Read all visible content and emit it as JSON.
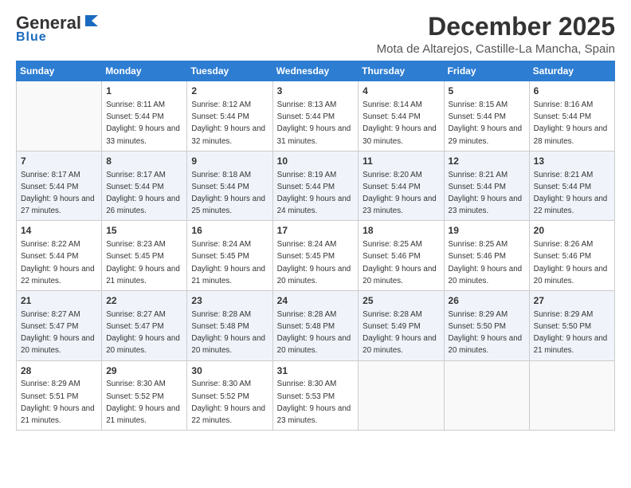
{
  "header": {
    "logo_general": "General",
    "logo_blue": "Blue",
    "month_title": "December 2025",
    "location": "Mota de Altarejos, Castille-La Mancha, Spain"
  },
  "days_of_week": [
    "Sunday",
    "Monday",
    "Tuesday",
    "Wednesday",
    "Thursday",
    "Friday",
    "Saturday"
  ],
  "weeks": [
    [
      {
        "day": "",
        "sunrise": "",
        "sunset": "",
        "daylight": ""
      },
      {
        "day": "1",
        "sunrise": "Sunrise: 8:11 AM",
        "sunset": "Sunset: 5:44 PM",
        "daylight": "Daylight: 9 hours and 33 minutes."
      },
      {
        "day": "2",
        "sunrise": "Sunrise: 8:12 AM",
        "sunset": "Sunset: 5:44 PM",
        "daylight": "Daylight: 9 hours and 32 minutes."
      },
      {
        "day": "3",
        "sunrise": "Sunrise: 8:13 AM",
        "sunset": "Sunset: 5:44 PM",
        "daylight": "Daylight: 9 hours and 31 minutes."
      },
      {
        "day": "4",
        "sunrise": "Sunrise: 8:14 AM",
        "sunset": "Sunset: 5:44 PM",
        "daylight": "Daylight: 9 hours and 30 minutes."
      },
      {
        "day": "5",
        "sunrise": "Sunrise: 8:15 AM",
        "sunset": "Sunset: 5:44 PM",
        "daylight": "Daylight: 9 hours and 29 minutes."
      },
      {
        "day": "6",
        "sunrise": "Sunrise: 8:16 AM",
        "sunset": "Sunset: 5:44 PM",
        "daylight": "Daylight: 9 hours and 28 minutes."
      }
    ],
    [
      {
        "day": "7",
        "sunrise": "Sunrise: 8:17 AM",
        "sunset": "Sunset: 5:44 PM",
        "daylight": "Daylight: 9 hours and 27 minutes."
      },
      {
        "day": "8",
        "sunrise": "Sunrise: 8:17 AM",
        "sunset": "Sunset: 5:44 PM",
        "daylight": "Daylight: 9 hours and 26 minutes."
      },
      {
        "day": "9",
        "sunrise": "Sunrise: 8:18 AM",
        "sunset": "Sunset: 5:44 PM",
        "daylight": "Daylight: 9 hours and 25 minutes."
      },
      {
        "day": "10",
        "sunrise": "Sunrise: 8:19 AM",
        "sunset": "Sunset: 5:44 PM",
        "daylight": "Daylight: 9 hours and 24 minutes."
      },
      {
        "day": "11",
        "sunrise": "Sunrise: 8:20 AM",
        "sunset": "Sunset: 5:44 PM",
        "daylight": "Daylight: 9 hours and 23 minutes."
      },
      {
        "day": "12",
        "sunrise": "Sunrise: 8:21 AM",
        "sunset": "Sunset: 5:44 PM",
        "daylight": "Daylight: 9 hours and 23 minutes."
      },
      {
        "day": "13",
        "sunrise": "Sunrise: 8:21 AM",
        "sunset": "Sunset: 5:44 PM",
        "daylight": "Daylight: 9 hours and 22 minutes."
      }
    ],
    [
      {
        "day": "14",
        "sunrise": "Sunrise: 8:22 AM",
        "sunset": "Sunset: 5:44 PM",
        "daylight": "Daylight: 9 hours and 22 minutes."
      },
      {
        "day": "15",
        "sunrise": "Sunrise: 8:23 AM",
        "sunset": "Sunset: 5:45 PM",
        "daylight": "Daylight: 9 hours and 21 minutes."
      },
      {
        "day": "16",
        "sunrise": "Sunrise: 8:24 AM",
        "sunset": "Sunset: 5:45 PM",
        "daylight": "Daylight: 9 hours and 21 minutes."
      },
      {
        "day": "17",
        "sunrise": "Sunrise: 8:24 AM",
        "sunset": "Sunset: 5:45 PM",
        "daylight": "Daylight: 9 hours and 20 minutes."
      },
      {
        "day": "18",
        "sunrise": "Sunrise: 8:25 AM",
        "sunset": "Sunset: 5:46 PM",
        "daylight": "Daylight: 9 hours and 20 minutes."
      },
      {
        "day": "19",
        "sunrise": "Sunrise: 8:25 AM",
        "sunset": "Sunset: 5:46 PM",
        "daylight": "Daylight: 9 hours and 20 minutes."
      },
      {
        "day": "20",
        "sunrise": "Sunrise: 8:26 AM",
        "sunset": "Sunset: 5:46 PM",
        "daylight": "Daylight: 9 hours and 20 minutes."
      }
    ],
    [
      {
        "day": "21",
        "sunrise": "Sunrise: 8:27 AM",
        "sunset": "Sunset: 5:47 PM",
        "daylight": "Daylight: 9 hours and 20 minutes."
      },
      {
        "day": "22",
        "sunrise": "Sunrise: 8:27 AM",
        "sunset": "Sunset: 5:47 PM",
        "daylight": "Daylight: 9 hours and 20 minutes."
      },
      {
        "day": "23",
        "sunrise": "Sunrise: 8:28 AM",
        "sunset": "Sunset: 5:48 PM",
        "daylight": "Daylight: 9 hours and 20 minutes."
      },
      {
        "day": "24",
        "sunrise": "Sunrise: 8:28 AM",
        "sunset": "Sunset: 5:48 PM",
        "daylight": "Daylight: 9 hours and 20 minutes."
      },
      {
        "day": "25",
        "sunrise": "Sunrise: 8:28 AM",
        "sunset": "Sunset: 5:49 PM",
        "daylight": "Daylight: 9 hours and 20 minutes."
      },
      {
        "day": "26",
        "sunrise": "Sunrise: 8:29 AM",
        "sunset": "Sunset: 5:50 PM",
        "daylight": "Daylight: 9 hours and 20 minutes."
      },
      {
        "day": "27",
        "sunrise": "Sunrise: 8:29 AM",
        "sunset": "Sunset: 5:50 PM",
        "daylight": "Daylight: 9 hours and 21 minutes."
      }
    ],
    [
      {
        "day": "28",
        "sunrise": "Sunrise: 8:29 AM",
        "sunset": "Sunset: 5:51 PM",
        "daylight": "Daylight: 9 hours and 21 minutes."
      },
      {
        "day": "29",
        "sunrise": "Sunrise: 8:30 AM",
        "sunset": "Sunset: 5:52 PM",
        "daylight": "Daylight: 9 hours and 21 minutes."
      },
      {
        "day": "30",
        "sunrise": "Sunrise: 8:30 AM",
        "sunset": "Sunset: 5:52 PM",
        "daylight": "Daylight: 9 hours and 22 minutes."
      },
      {
        "day": "31",
        "sunrise": "Sunrise: 8:30 AM",
        "sunset": "Sunset: 5:53 PM",
        "daylight": "Daylight: 9 hours and 23 minutes."
      },
      {
        "day": "",
        "sunrise": "",
        "sunset": "",
        "daylight": ""
      },
      {
        "day": "",
        "sunrise": "",
        "sunset": "",
        "daylight": ""
      },
      {
        "day": "",
        "sunrise": "",
        "sunset": "",
        "daylight": ""
      }
    ]
  ]
}
